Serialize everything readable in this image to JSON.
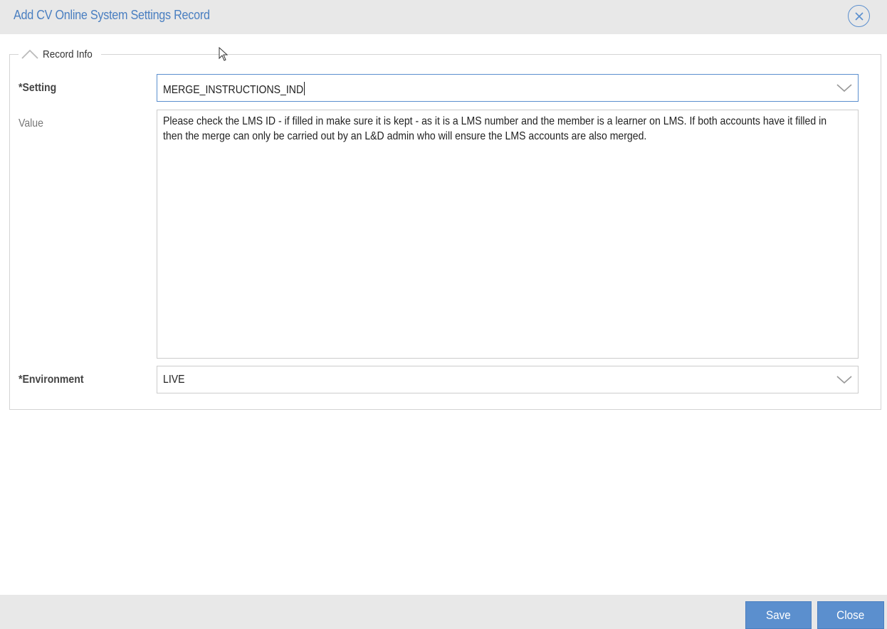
{
  "dialog": {
    "title": "Add CV Online System Settings Record"
  },
  "section": {
    "legend": "Record Info"
  },
  "form": {
    "setting": {
      "label": "*Setting",
      "value": "MERGE_INSTRUCTIONS_IND"
    },
    "value": {
      "label": "Value",
      "text": "Please check the LMS ID - if filled in make sure it is kept - as it is a LMS number and the member is a learner on LMS. If both accounts have it filled in then the merge can only be carried out by an L&D admin who will ensure the LMS accounts are also merged."
    },
    "environment": {
      "label": "*Environment",
      "value": "LIVE"
    }
  },
  "footer": {
    "save_label": "Save",
    "close_label": "Close"
  },
  "colors": {
    "accent": "#5b8fce",
    "title_text": "#4a7fc1",
    "bar_background": "#e8e8e8"
  },
  "icons": {
    "dialog_close": "close-circle-icon",
    "section_toggle": "chevron-up-icon",
    "dropdown": "chevron-down-icon",
    "pointer": "mouse-cursor-icon"
  }
}
